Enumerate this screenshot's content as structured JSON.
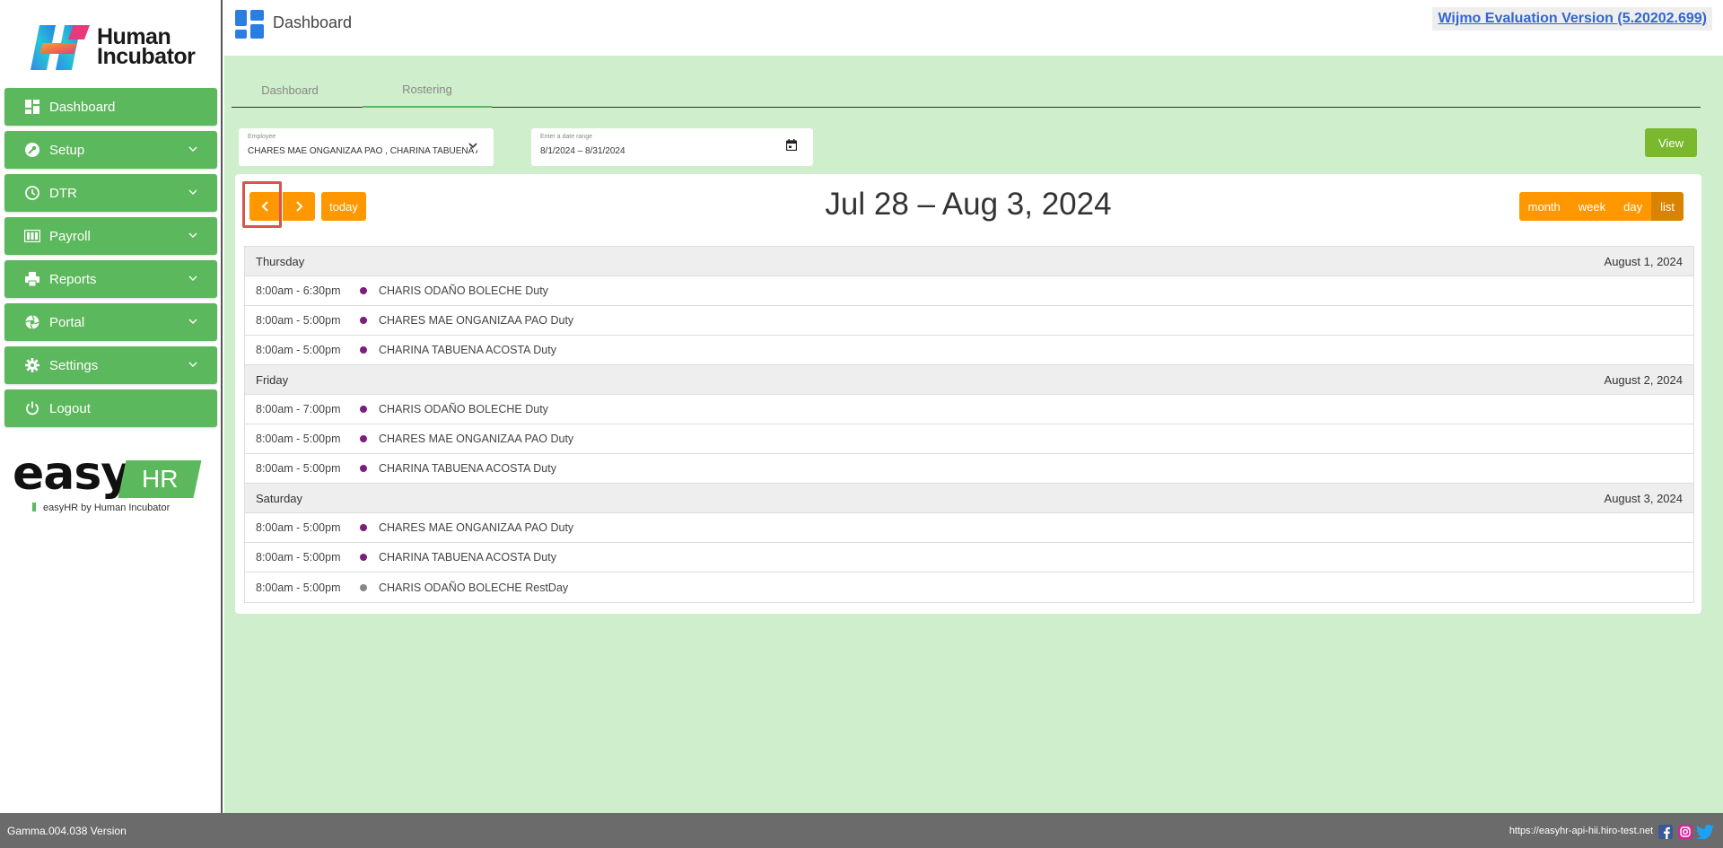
{
  "sidebar": {
    "brand": {
      "line1": "Human",
      "line2": "Incubator"
    },
    "items": [
      {
        "label": "Dashboard",
        "icon": "dashboard-icon",
        "expandable": false
      },
      {
        "label": "Setup",
        "icon": "wrench-icon",
        "expandable": true
      },
      {
        "label": "DTR",
        "icon": "clock-icon",
        "expandable": true
      },
      {
        "label": "Payroll",
        "icon": "payroll-icon",
        "expandable": true
      },
      {
        "label": "Reports",
        "icon": "printer-icon",
        "expandable": true
      },
      {
        "label": "Portal",
        "icon": "aperture-icon",
        "expandable": true
      },
      {
        "label": "Settings",
        "icon": "gear-icon",
        "expandable": true
      },
      {
        "label": "Logout",
        "icon": "power-icon",
        "expandable": false
      }
    ],
    "footer_logo": {
      "word": "easy",
      "box": "HR",
      "tagline": "easyHR by Human Incubator"
    }
  },
  "topbar": {
    "title": "Dashboard",
    "wijmo": "Wijmo Evaluation Version (5.20202.699)"
  },
  "tabs": [
    {
      "label": "Dashboard",
      "active": false
    },
    {
      "label": "Rostering",
      "active": true
    }
  ],
  "filters": {
    "employee_label": "Employee",
    "employee_value": "CHARES MAE ONGANIZAA PAO , CHARINA TABUENA ACOSTA",
    "date_label": "Enter a date range",
    "date_value": "8/1/2024 – 8/31/2024",
    "view_button": "View"
  },
  "calendar": {
    "title": "Jul 28 – Aug 3, 2024",
    "today": "today",
    "views": [
      "month",
      "week",
      "day",
      "list"
    ],
    "active_view": "list",
    "days": [
      {
        "name": "Thursday",
        "date": "August 1, 2024",
        "events": [
          {
            "time": "8:00am - 6:30pm",
            "title": "CHARIS ODAÑO BOLECHE Duty",
            "color": "#7b1f7b"
          },
          {
            "time": "8:00am - 5:00pm",
            "title": "CHARES MAE ONGANIZAA PAO Duty",
            "color": "#7b1f7b"
          },
          {
            "time": "8:00am - 5:00pm",
            "title": "CHARINA TABUENA ACOSTA Duty",
            "color": "#7b1f7b"
          }
        ]
      },
      {
        "name": "Friday",
        "date": "August 2, 2024",
        "events": [
          {
            "time": "8:00am - 7:00pm",
            "title": "CHARIS ODAÑO BOLECHE Duty",
            "color": "#7b1f7b"
          },
          {
            "time": "8:00am - 5:00pm",
            "title": "CHARES MAE ONGANIZAA PAO Duty",
            "color": "#7b1f7b"
          },
          {
            "time": "8:00am - 5:00pm",
            "title": "CHARINA TABUENA ACOSTA Duty",
            "color": "#7b1f7b"
          }
        ]
      },
      {
        "name": "Saturday",
        "date": "August 3, 2024",
        "events": [
          {
            "time": "8:00am - 5:00pm",
            "title": "CHARES MAE ONGANIZAA PAO Duty",
            "color": "#7b1f7b"
          },
          {
            "time": "8:00am - 5:00pm",
            "title": "CHARINA TABUENA ACOSTA Duty",
            "color": "#7b1f7b"
          },
          {
            "time": "8:00am - 5:00pm",
            "title": "CHARIS ODAÑO BOLECHE RestDay",
            "color": "#888888"
          }
        ]
      }
    ]
  },
  "footer": {
    "version": "Gamma.004.038 Version",
    "url": "https://easyhr-api-hii.hiro-test.net",
    "social": [
      "facebook-icon",
      "instagram-icon",
      "twitter-icon"
    ]
  }
}
